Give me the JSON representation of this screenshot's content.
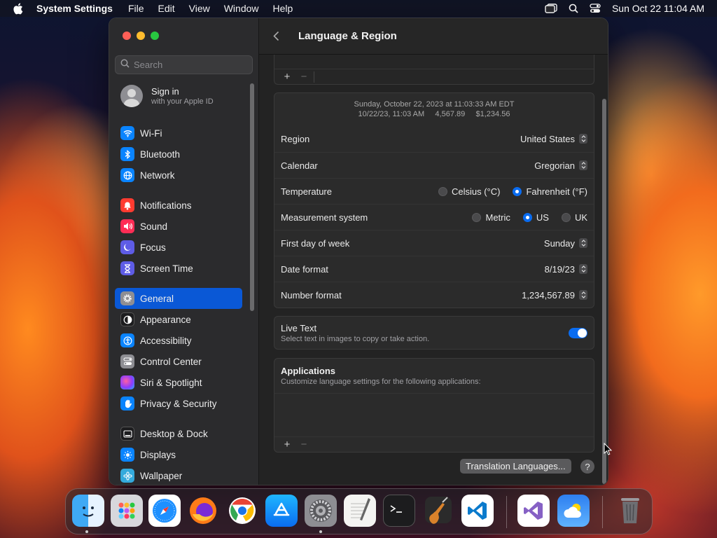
{
  "menubar": {
    "app_name": "System Settings",
    "menus": [
      "File",
      "Edit",
      "View",
      "Window",
      "Help"
    ],
    "clock": "Sun Oct 22  11:04 AM"
  },
  "sidebar": {
    "search_placeholder": "Search",
    "signin_title": "Sign in",
    "signin_subtitle": "with your Apple ID",
    "groups": [
      [
        {
          "label": "Wi-Fi",
          "icon": "wifi-icon",
          "color": "#0a84ff"
        },
        {
          "label": "Bluetooth",
          "icon": "bluetooth-icon",
          "color": "#0a84ff"
        },
        {
          "label": "Network",
          "icon": "globe-icon",
          "color": "#0a84ff"
        }
      ],
      [
        {
          "label": "Notifications",
          "icon": "bell-icon",
          "color": "#ff3b30"
        },
        {
          "label": "Sound",
          "icon": "speaker-icon",
          "color": "#ff2d55"
        },
        {
          "label": "Focus",
          "icon": "moon-icon",
          "color": "#5e5ce6"
        },
        {
          "label": "Screen Time",
          "icon": "hourglass-icon",
          "color": "#5e5ce6"
        }
      ],
      [
        {
          "label": "General",
          "icon": "gear-icon",
          "color": "#8e8e93"
        },
        {
          "label": "Appearance",
          "icon": "appearance-icon",
          "color": "#1c1c1e"
        },
        {
          "label": "Accessibility",
          "icon": "accessibility-icon",
          "color": "#0a84ff"
        },
        {
          "label": "Control Center",
          "icon": "control-center-icon",
          "color": "#8e8e93"
        },
        {
          "label": "Siri & Spotlight",
          "icon": "siri-icon",
          "color": "#bf5af2"
        },
        {
          "label": "Privacy & Security",
          "icon": "hand-icon",
          "color": "#0a84ff"
        }
      ],
      [
        {
          "label": "Desktop & Dock",
          "icon": "dock-icon",
          "color": "#1c1c1e"
        },
        {
          "label": "Displays",
          "icon": "sun-icon",
          "color": "#0a84ff"
        },
        {
          "label": "Wallpaper",
          "icon": "flower-icon",
          "color": "#34aadc"
        }
      ]
    ],
    "active": "General"
  },
  "content": {
    "title": "Language & Region",
    "add_symbol": "+",
    "remove_symbol": "−",
    "preview_line1": "Sunday, October 22, 2023 at 11:03:33 AM EDT",
    "preview_line2": "10/22/23, 11:03 AM     4,567.89     $1,234.56",
    "rows": {
      "region": {
        "label": "Region",
        "value": "United States"
      },
      "calendar": {
        "label": "Calendar",
        "value": "Gregorian"
      },
      "temperature": {
        "label": "Temperature",
        "options": [
          "Celsius (°C)",
          "Fahrenheit (°F)"
        ],
        "selected": "Fahrenheit (°F)"
      },
      "measurement": {
        "label": "Measurement system",
        "options": [
          "Metric",
          "US",
          "UK"
        ],
        "selected": "US"
      },
      "first_day": {
        "label": "First day of week",
        "value": "Sunday"
      },
      "date_format": {
        "label": "Date format",
        "value": "8/19/23"
      },
      "number_format": {
        "label": "Number format",
        "value": "1,234,567.89"
      }
    },
    "live_text": {
      "title": "Live Text",
      "subtitle": "Select text in images to copy or take action.",
      "enabled": true
    },
    "applications": {
      "title": "Applications",
      "subtitle": "Customize language settings for the following applications:"
    },
    "translation_button": "Translation Languages...",
    "help_symbol": "?"
  },
  "dock": {
    "apps": [
      "Finder",
      "Launchpad",
      "Safari",
      "Firefox",
      "Chrome",
      "App Store",
      "System Settings",
      "TextEdit",
      "Terminal",
      "GarageBand",
      "Visual Studio Code",
      "Visual Studio",
      "Weather",
      "Trash"
    ]
  },
  "colors": {
    "accent": "#0a58d6",
    "toggle": "#0a6cf0"
  }
}
